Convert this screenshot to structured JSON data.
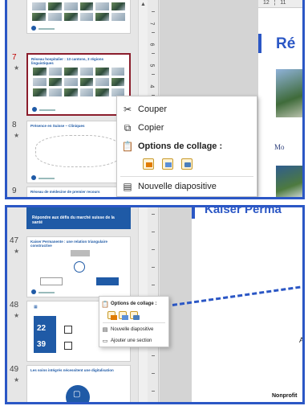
{
  "top": {
    "ruler_labels": [
      "12",
      "11"
    ],
    "vertical_ticks": [
      "7",
      "6",
      "5",
      "4"
    ],
    "slides": [
      {
        "number": "7",
        "title": "Réseau hospitalier : 13 cantons, 3 régions linguistiques"
      },
      {
        "number": "8",
        "title": "Présence en Suisse – Cliniques"
      },
      {
        "number": "9",
        "title": "Réseau de médecine de premier recours"
      }
    ],
    "right_title": "Ré",
    "right_caption": "Mo",
    "menu": {
      "cut": "Couper",
      "copy": "Copier",
      "paste_options": "Options de collage :",
      "new_slide": "Nouvelle diapositive"
    }
  },
  "bottom": {
    "header_text": "Répondre aux défis du marché suisse de la santé",
    "right_title": "Kaiser Perma",
    "right_edge_letter": "A",
    "right_footer": "Nonprofit",
    "slides": [
      {
        "number": "47",
        "title": "Kaiser Permanente : une relation triangulaire constructive"
      },
      {
        "number": "48",
        "title": "",
        "stat1": "22",
        "stat2": "39"
      },
      {
        "number": "49",
        "title": "Les soins intégrés nécessitent une digitalisation"
      }
    ],
    "menu": {
      "paste_options": "Options de collage :",
      "new_slide": "Nouvelle diapositive",
      "add_section": "Ajouter une section"
    }
  }
}
